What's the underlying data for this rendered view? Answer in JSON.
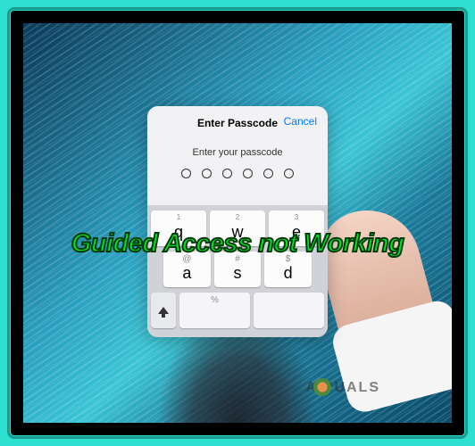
{
  "dialog": {
    "title": "Enter Passcode",
    "cancel_label": "Cancel",
    "prompt": "Enter your passcode",
    "passcode_length": 6
  },
  "keyboard": {
    "row1": [
      {
        "num": "1",
        "letter": "q"
      },
      {
        "num": "2",
        "letter": "w"
      },
      {
        "num": "3",
        "letter": "e"
      }
    ],
    "row2": [
      {
        "sym": "@",
        "letter": "a"
      },
      {
        "sym": "#",
        "letter": "s"
      },
      {
        "sym": "$",
        "letter": "d"
      }
    ],
    "row3": [
      {
        "sym": "%",
        "letter": ""
      },
      {
        "sym": "",
        "letter": ""
      }
    ]
  },
  "overlay": {
    "caption": "Guided Access not Working"
  },
  "watermark": {
    "text": "A  PUALS"
  },
  "colors": {
    "frame": "#2de0d0",
    "ios_blue": "#007aff",
    "caption_green": "#00e028"
  }
}
